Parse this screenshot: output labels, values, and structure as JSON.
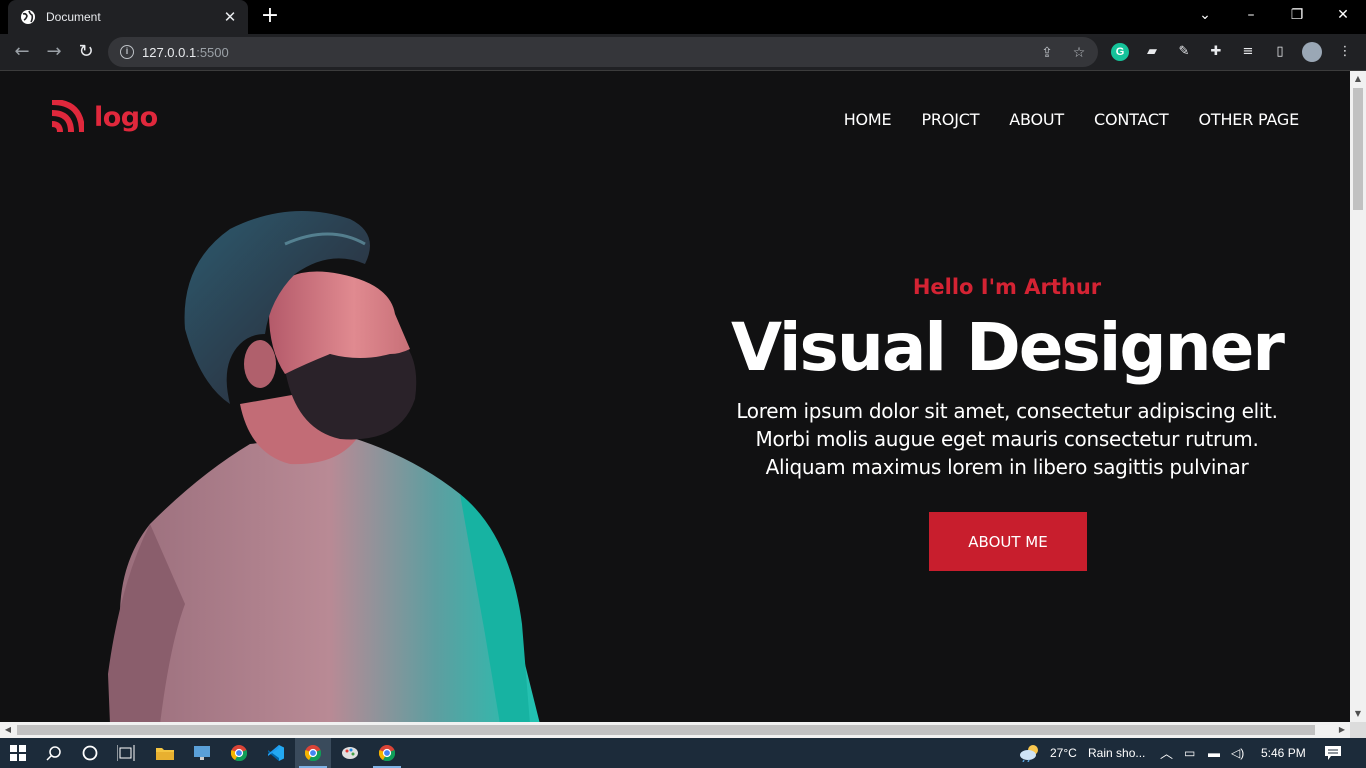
{
  "browser": {
    "tab_title": "Document",
    "tab_close": "✕",
    "new_tab": "+",
    "url_host": "127.0.0.1",
    "url_port": ":5500",
    "back": "←",
    "forward": "→",
    "reload": "↻",
    "window_controls": {
      "tabs_menu": "⌄",
      "minimize": "–",
      "restore": "❐",
      "close": "✕"
    }
  },
  "site": {
    "logo_text": "logo",
    "nav": [
      "HOME",
      "PROJCT",
      "ABOUT",
      "CONTACT",
      "OTHER PAGE"
    ],
    "hero": {
      "greeting": "Hello I'm Arthur",
      "title": "Visual Designer",
      "description_lines": [
        "Lorem ipsum dolor sit amet, consectetur adipiscing elit.",
        "Morbi molis augue eget mauris consectetur rutrum.",
        "Aliquam maximus lorem in libero sagittis pulvinar"
      ],
      "cta": "ABOUT ME"
    },
    "colors": {
      "accent": "#c81e2d",
      "background": "#111112",
      "text": "#ffffff"
    }
  },
  "taskbar": {
    "weather_temp": "27°C",
    "weather_text": "Rain sho...",
    "clock": "5:46 PM",
    "icons": [
      "windows-start-icon",
      "search-icon",
      "cortana-icon",
      "task-view-icon",
      "file-explorer-icon",
      "remote-desktop-icon",
      "chrome-icon",
      "vscode-icon",
      "chrome-icon",
      "paint-icon",
      "chrome-icon"
    ]
  }
}
